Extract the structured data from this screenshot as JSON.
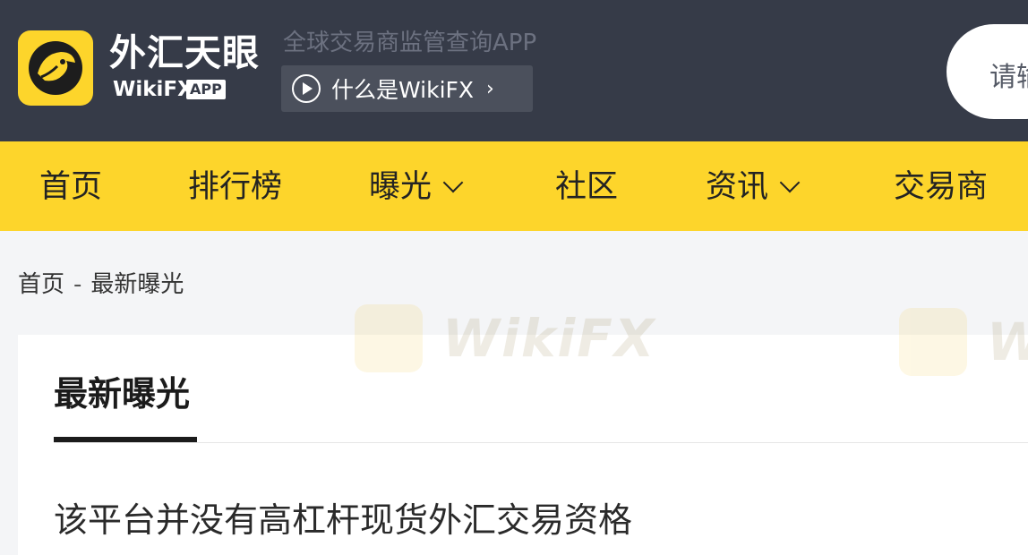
{
  "header": {
    "brand_cn": "外汇天眼",
    "brand_en": "WikiFX",
    "app_badge": "APP",
    "slogan": "全球交易商监管查询APP",
    "whatis_label": "什么是WikiFX",
    "search_partial": "请输"
  },
  "nav": {
    "items": [
      {
        "label": "首页",
        "has_dropdown": false
      },
      {
        "label": "排行榜",
        "has_dropdown": false
      },
      {
        "label": "曝光",
        "has_dropdown": true
      },
      {
        "label": "社区",
        "has_dropdown": false
      },
      {
        "label": "资讯",
        "has_dropdown": true
      },
      {
        "label": "交易商",
        "has_dropdown": false
      }
    ]
  },
  "breadcrumb": {
    "home": "首页",
    "separator": "-",
    "current": "最新曝光"
  },
  "main": {
    "section_title": "最新曝光",
    "article_title": "该平台并没有高杠杆现货外汇交易资格"
  },
  "watermark": {
    "text": "WikiFX"
  },
  "colors": {
    "header_bg": "#363b48",
    "accent_yellow": "#fdd52b",
    "page_bg": "#f4f5f7"
  },
  "icons": {
    "logo": "eagle-logo-icon",
    "play": "play-circle-icon",
    "chevron": "chevron-right-icon",
    "dropdown": "chevron-down-icon"
  }
}
